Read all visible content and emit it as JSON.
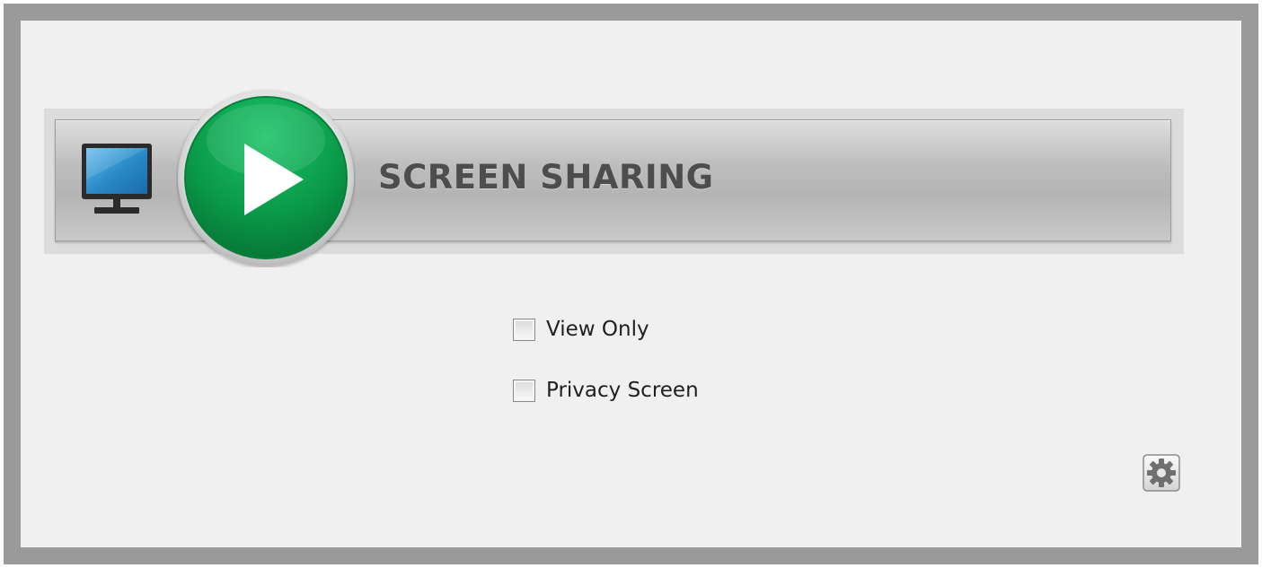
{
  "window": {
    "title": "SCREEN SHARING"
  },
  "header_bar": {
    "title": "SCREEN SHARING",
    "monitor_icon": "monitor-icon",
    "play_icon": "play-icon",
    "play_color": "#0a9a4a"
  },
  "options": {
    "view_only": {
      "label": "View Only",
      "checked": false
    },
    "privacy_screen": {
      "label": "Privacy Screen",
      "checked": false
    }
  },
  "settings": {
    "icon": "gear-icon"
  },
  "colors": {
    "frame": "#9a9a9a",
    "background": "#f0f0f0",
    "title_text": "#4d4d4d",
    "monitor_screen": "#2a8cc8"
  }
}
